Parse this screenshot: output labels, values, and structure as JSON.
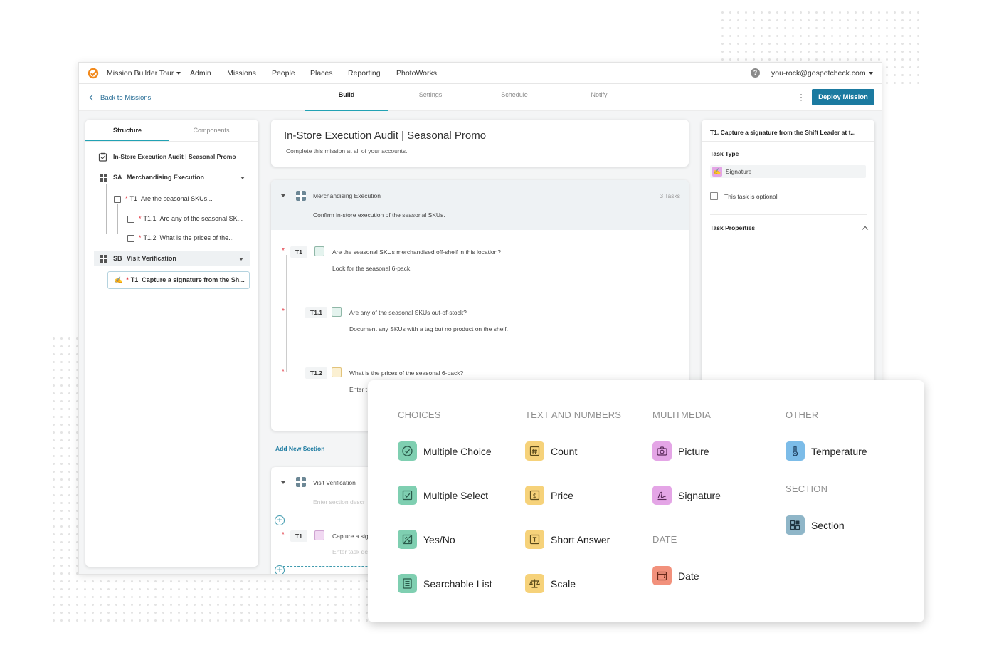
{
  "topnav": {
    "app_name": "Mission Builder Tour",
    "items": [
      "Admin",
      "Missions",
      "People",
      "Places",
      "Reporting",
      "PhotoWorks"
    ],
    "user": "you-rock@gospotcheck.com"
  },
  "subbar": {
    "back": "Back to Missions",
    "tabs": [
      "Build",
      "Settings",
      "Schedule",
      "Notify"
    ],
    "deploy": "Deploy Mission"
  },
  "structure": {
    "tabs": [
      "Structure",
      "Components"
    ],
    "mission": "In-Store Execution Audit | Seasonal Promo",
    "rows": [
      {
        "prefix": "SA",
        "label": "Merchandising Execution"
      },
      {
        "prefix": "T1",
        "label": "Are the seasonal SKUs..."
      },
      {
        "prefix": "T1.1",
        "label": "Are any of the seasonal SK..."
      },
      {
        "prefix": "T1.2",
        "label": "What is the prices of the..."
      },
      {
        "prefix": "SB",
        "label": "Visit Verification"
      },
      {
        "prefix": "T1",
        "label": "Capture a signature from the Sh..."
      }
    ]
  },
  "mission": {
    "title": "In-Store Execution Audit | Seasonal Promo",
    "subtitle": "Complete this mission at all of your accounts."
  },
  "section_a": {
    "name": "Merchandising Execution",
    "count": "3 Tasks",
    "description": "Confirm in-store execution of the seasonal SKUs.",
    "tasks": [
      {
        "tag": "T1",
        "question": "Are the seasonal SKUs merchandised off-shelf in this location?",
        "note": "Look for the seasonal 6-pack."
      },
      {
        "tag": "T1.1",
        "question": "Are any of the seasonal SKUs out-of-stock?",
        "note": "Document any SKUs with a tag but no product on the shelf."
      },
      {
        "tag": "T1.2",
        "question": "What is the prices of the seasonal 6-pack?",
        "note": "Enter t"
      }
    ]
  },
  "add_section": "Add New Section",
  "section_b": {
    "name": "Visit Verification",
    "placeholder": "Enter section descr",
    "task_tag": "T1",
    "task_text": "Capture a sig",
    "task_placeholder": "Enter task de"
  },
  "task_panel": {
    "header": "T1. Capture a signature from the Shift Leader at t...",
    "type_label": "Task Type",
    "type_value": "Signature",
    "optional_label": "This task is optional",
    "properties_label": "Task Properties"
  },
  "palette": {
    "categories": {
      "choices": "CHOICES",
      "text_numbers": "TEXT AND NUMBERS",
      "multimedia": "MULITMEDIA",
      "other": "OTHER",
      "section": "SECTION",
      "date": "DATE"
    },
    "choices": [
      {
        "label": "Multiple Choice",
        "icon": "check-circle-icon"
      },
      {
        "label": "Multiple Select",
        "icon": "checkbox-icon"
      },
      {
        "label": "Yes/No",
        "icon": "yes-no-icon"
      },
      {
        "label": "Searchable List",
        "icon": "list-icon"
      }
    ],
    "text_numbers": [
      {
        "label": "Count",
        "icon": "hash-icon"
      },
      {
        "label": "Price",
        "icon": "dollar-icon"
      },
      {
        "label": "Short Answer",
        "icon": "text-icon"
      },
      {
        "label": "Scale",
        "icon": "scale-icon"
      }
    ],
    "multimedia": [
      {
        "label": "Picture",
        "icon": "camera-icon"
      },
      {
        "label": "Signature",
        "icon": "signature-icon"
      }
    ],
    "other": [
      {
        "label": "Temperature",
        "icon": "thermometer-icon"
      }
    ],
    "section": [
      {
        "label": "Section",
        "icon": "section-grid-icon"
      }
    ],
    "date": [
      {
        "label": "Date",
        "icon": "calendar-icon"
      }
    ]
  },
  "colors": {
    "accent": "#21a2b4",
    "deploy_button": "#1b7aa0",
    "required": "#e0303b",
    "choices_icon": "#7fcfb1",
    "text_icon": "#f6d27a",
    "media_icon": "#e4a5e6",
    "other_icon": "#7cbce8",
    "date_icon": "#f2917c"
  }
}
